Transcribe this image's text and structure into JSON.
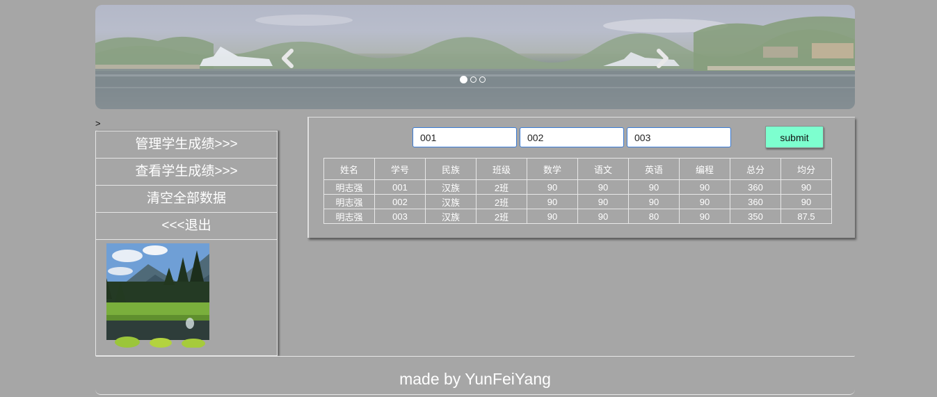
{
  "carousel": {
    "prev_icon": "chevron-left-icon",
    "next_icon": "chevron-right-icon",
    "slide_count": 3,
    "active_slide": 1
  },
  "marker_text": ">",
  "sidebar": {
    "items": [
      {
        "label": "管理学生成绩>>>"
      },
      {
        "label": "查看学生成绩>>>"
      },
      {
        "label": "清空全部数据"
      },
      {
        "label": "<<<退出"
      }
    ]
  },
  "form": {
    "inputs": [
      {
        "value": "001"
      },
      {
        "value": "002"
      },
      {
        "value": "003"
      }
    ],
    "submit_label": "submit"
  },
  "table": {
    "headers": [
      "姓名",
      "学号",
      "民族",
      "班级",
      "数学",
      "语文",
      "英语",
      "编程",
      "总分",
      "均分"
    ],
    "rows": [
      [
        "明志强",
        "001",
        "汉族",
        "2班",
        "90",
        "90",
        "90",
        "90",
        "360",
        "90"
      ],
      [
        "明志强",
        "002",
        "汉族",
        "2班",
        "90",
        "90",
        "90",
        "90",
        "360",
        "90"
      ],
      [
        "明志强",
        "003",
        "汉族",
        "2班",
        "90",
        "90",
        "80",
        "90",
        "350",
        "87.5"
      ]
    ]
  },
  "footer": {
    "text": "made by YunFeiYang"
  },
  "colors": {
    "page_background": "#a6a6a6",
    "submit_button": "#7dffcf",
    "input_border": "#3a7bd5",
    "text_light": "#ffffff"
  }
}
